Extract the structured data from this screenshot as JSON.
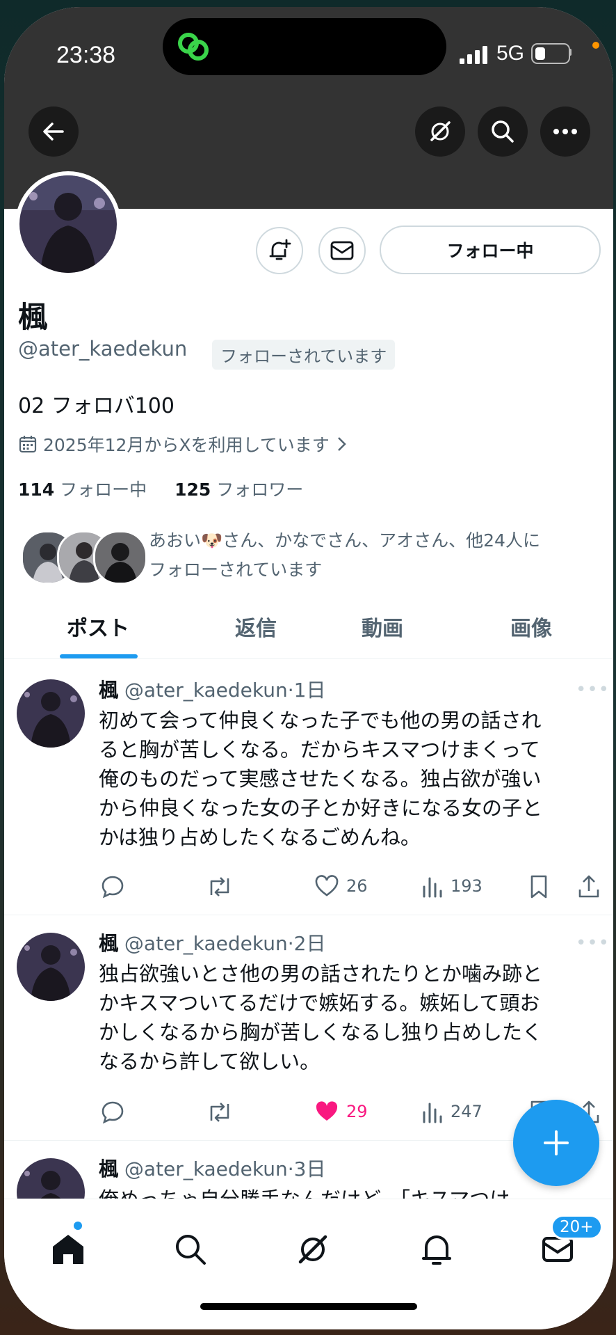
{
  "status_bar": {
    "time": "23:38",
    "network": "5G"
  },
  "profile": {
    "name": "楓",
    "handle": "@ater_kaedekun",
    "follows_you": "フォローされています",
    "follow_button": "フォロー中",
    "bio": "02 フォロバ100",
    "joined": "2025年12月からXを利用しています",
    "following_count": "114",
    "following_label": "フォロー中",
    "followers_count": "125",
    "followers_label": "フォロワー",
    "mutuals_line1": "あおい🐶さん、かなでさん、アオさん、他24人に",
    "mutuals_line2": "フォローされています"
  },
  "tabs": [
    "ポスト",
    "返信",
    "動画",
    "画像"
  ],
  "tweets": [
    {
      "name": "楓",
      "handle": "@ater_kaedekun",
      "time": "·1日",
      "lines": [
        "初めて会って仲良くなった子でも他の男の話され",
        "ると胸が苦しくなる。だからキスマつけまくって",
        "俺のものだって実感させたくなる。独占欲が強い",
        "から仲良くなった女の子とか好きになる女の子と",
        "かは独り占めしたくなるごめんね。"
      ],
      "likes": "26",
      "views": "193",
      "liked": false
    },
    {
      "name": "楓",
      "handle": "@ater_kaedekun",
      "time": "·2日",
      "lines": [
        "独占欲強いとさ他の男の話されたりとか噛み跡と",
        "かキスマついてるだけで嫉妬する。嫉妬して頭お",
        "かしくなるから胸が苦しくなるし独り占めしたく",
        "なるから許して欲しい。"
      ],
      "likes": "29",
      "views": "247",
      "liked": true
    },
    {
      "name": "楓",
      "handle": "@ater_kaedekun",
      "time": "·3日",
      "lines": [
        "俺めっちゃ自分勝手なんだけど、「キスマつけ…"
      ]
    }
  ],
  "messages_badge": "20+",
  "colors": {
    "accent": "#1d9bf0",
    "like": "#f91880",
    "header": "#333333"
  },
  "icons": [
    "back-arrow-icon",
    "grok-icon",
    "search-icon",
    "more-icon",
    "bell-plus-icon",
    "mail-icon",
    "calendar-icon",
    "reply-icon",
    "retweet-icon",
    "heart-icon",
    "views-icon",
    "bookmark-icon",
    "share-icon",
    "plus-icon",
    "home-icon",
    "bell-icon"
  ]
}
